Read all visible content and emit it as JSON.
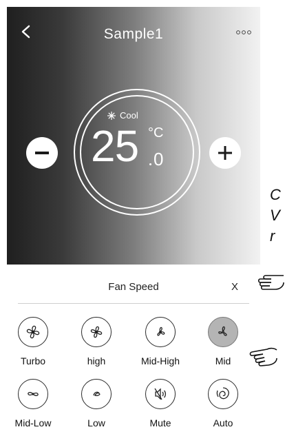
{
  "header": {
    "title": "Sample1",
    "back_icon": "back-chevron-icon",
    "more_icon": "more-dots-icon"
  },
  "control": {
    "mode_label": "Cool",
    "mode_icon": "snowflake-icon",
    "temperature": "25",
    "unit": "°C",
    "decimal": "0",
    "minus_icon": "minus-icon",
    "plus_icon": "plus-icon"
  },
  "fan_speed": {
    "title": "Fan Speed",
    "close_label": "X",
    "selected": "Mid",
    "options": [
      {
        "label": "Turbo",
        "icon": "fan-turbo-icon"
      },
      {
        "label": "high",
        "icon": "fan-high-icon"
      },
      {
        "label": "Mid-High",
        "icon": "fan-mid-high-icon"
      },
      {
        "label": "Mid",
        "icon": "fan-mid-icon"
      },
      {
        "label": "Mid-Low",
        "icon": "fan-mid-low-icon"
      },
      {
        "label": "Low",
        "icon": "fan-low-icon"
      },
      {
        "label": "Mute",
        "icon": "mute-icon"
      },
      {
        "label": "Auto",
        "icon": "auto-icon"
      }
    ]
  },
  "annotation": {
    "lines": [
      "C",
      "V",
      "r"
    ]
  },
  "colors": {
    "active_fan_bg": "#b4b4b4",
    "panel_dark": "#1f1f1f",
    "panel_light": "#f2f2f2"
  }
}
